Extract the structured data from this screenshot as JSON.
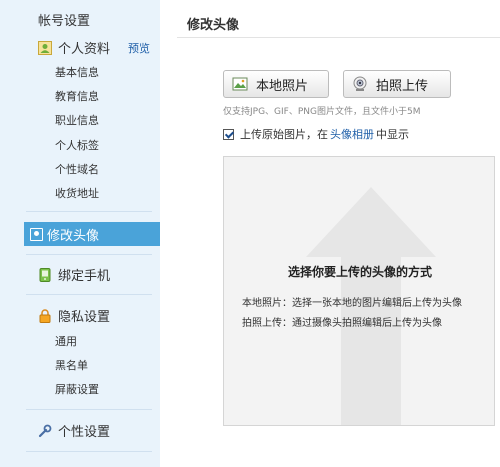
{
  "sidebar": {
    "title": "帐号设置",
    "profile": {
      "label": "个人资料",
      "preview": "预览",
      "items": [
        "基本信息",
        "教育信息",
        "职业信息",
        "个人标签",
        "个性域名",
        "收货地址"
      ]
    },
    "avatar": {
      "label": "修改头像"
    },
    "phone": {
      "label": "绑定手机"
    },
    "privacy": {
      "label": "隐私设置",
      "items": [
        "通用",
        "黑名单",
        "屏蔽设置"
      ]
    },
    "personal": {
      "label": "个性设置"
    }
  },
  "main": {
    "title": "修改头像",
    "buttons": {
      "local": "本地照片",
      "camera": "拍照上传"
    },
    "hint": "仅支持JPG、GIF、PNG图片文件，且文件小于5M",
    "checkbox": {
      "prefix": "上传原始图片，在",
      "link": "头像相册",
      "suffix": "中显示"
    },
    "box": {
      "title": "选择你要上传的头像的方式",
      "line1": "本地照片：选择一张本地的图片编辑后上传为头像",
      "line2": "拍照上传：通过摄像头拍照编辑后上传为头像"
    }
  },
  "colors": {
    "sidebar_bg": "#e9f3fb",
    "active_bg": "#4aa3d9",
    "link": "#1f5fa8"
  },
  "icons": [
    "profile-icon",
    "avatar-icon",
    "phone-icon",
    "lock-icon",
    "wrench-icon",
    "photo-icon",
    "camera-icon"
  ]
}
